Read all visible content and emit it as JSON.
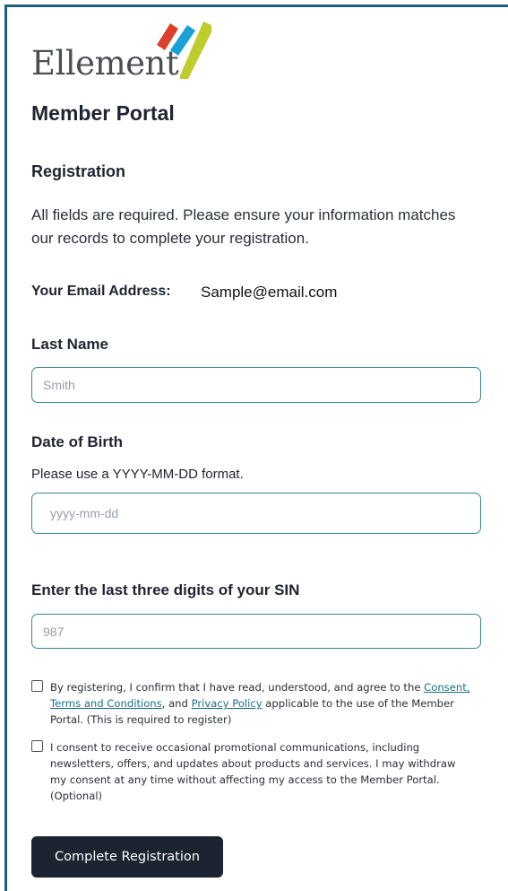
{
  "brand": {
    "name": "Ellement",
    "colors": {
      "red": "#d9412b",
      "blue": "#1aa1d6",
      "green": "#bfcd2c",
      "border": "#1f5f7a"
    }
  },
  "page": {
    "title": "Member Portal",
    "section_title": "Registration",
    "intro": "All fields are required. Please ensure your information matches our records to complete your registration."
  },
  "email": {
    "label": "Your Email Address:",
    "value": "Sample@email.com"
  },
  "fields": {
    "last_name": {
      "label": "Last Name",
      "placeholder": "Smith",
      "value": ""
    },
    "dob": {
      "label": "Date of Birth",
      "helper": "Please use a YYYY-MM-DD format.",
      "placeholder": "yyyy-mm-dd",
      "value": ""
    },
    "sin": {
      "label": "Enter the last three digits of your SIN",
      "placeholder": "987",
      "value": ""
    }
  },
  "consents": {
    "terms": {
      "text_before": "By registering, I confirm that I have read, understood, and agree to the ",
      "link1": "Consent, Terms and Conditions",
      "text_mid": ", and ",
      "link2": "Privacy Policy",
      "text_after": " applicable to the use of the Member Portal. (This is required to register)",
      "checked": false
    },
    "marketing": {
      "text": "I consent to receive occasional promotional communications, including newsletters, offers, and updates about products and services. I may withdraw my consent at any time without affecting my access to the Member Portal. (Optional)",
      "checked": false
    }
  },
  "actions": {
    "submit_label": "Complete Registration"
  }
}
